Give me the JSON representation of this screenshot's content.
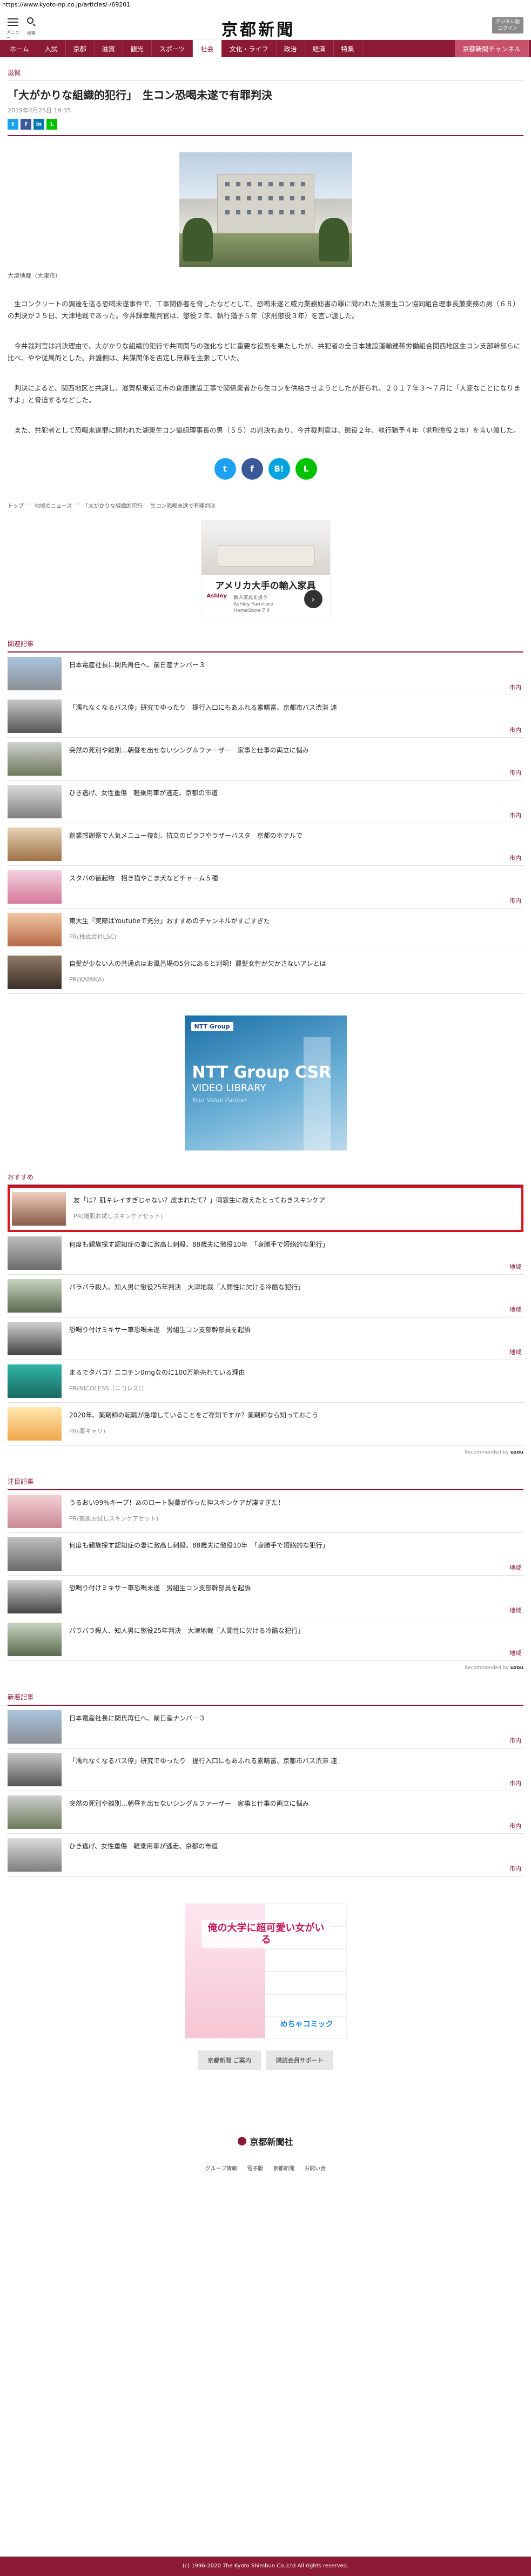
{
  "browser": {
    "url": "https://www.kyoto-np.co.jp/articles/-/69201"
  },
  "header": {
    "menu_label": "メニュー",
    "search_label": "検索",
    "logo": "京都新聞",
    "digital_line1": "デジタル版",
    "digital_line2": "ログイン"
  },
  "nav": {
    "items": [
      "ホーム",
      "入試",
      "京都",
      "滋賀",
      "観光",
      "スポーツ",
      "社会",
      "文化・ライフ",
      "政治",
      "経済",
      "特集"
    ],
    "special": "京都新聞チャンネル"
  },
  "article": {
    "section": "滋賀",
    "title": "「大がかりな組織的犯行」　生コン恐喝未遂で有罪判決",
    "date": "2019年4月25日 19:35",
    "caption": "大津地裁（大津市）",
    "paragraphs": [
      "生コンクリートの調達を巡る恐喝未遂事件で、工事関係者を脅したなどとして、恐喝未遂と威力業務妨害の罪に問われた湖東生コン協同組合理事長兼業務の男（６８）の判決が２５日、大津地裁であった。今井輝幸裁判官は、懲役２年、執行猶予５年（求刑懲役３年）を言い渡した。",
      "今井裁判官は判決理由で、大がかりな組織的犯行で共同関与の強化などに重要な役割を果たしたが、共犯者の全日本建設運輸連帯労働組合関西地区生コン支部幹部らに比べ、やや従属的とした。弁護側は、共謀関係を否定し無罪を主張していた。",
      "判決によると、関西地区と共謀し、滋賀県東近江市の倉庫建設工事で関係業者から生コンを供給させようとしたが断られ、２０１７年３〜７月に「大変なことになりますよ」と脅迫するなどした。",
      "また、共犯者として恐喝未遂罪に問われた湖東生コン協組理事長の男（５５）の判決もあり、今井裁判官は、懲役２年、執行猶予４年（求刑懲役２年）を言い渡した。"
    ]
  },
  "share": {
    "twitter": "t",
    "facebook": "f",
    "hatena": "B!",
    "line": "L",
    "linkedin": "in",
    "mini_line": "L"
  },
  "breadcrumb": [
    "トップ",
    "地域のニュース",
    "「大がかりな組織的犯行」　生コン恐喝未遂で有罪判決"
  ],
  "ad1": {
    "title": "アメリカ大手の輸入家具",
    "sub1": "輸入家具を扱う",
    "sub2": "Ashley Furniture",
    "sub3": "HomeStoreです",
    "brand": "Ashley",
    "arrow": "›"
  },
  "related": {
    "title": "関連記事",
    "items": [
      {
        "text": "日本電産社長に関氏再任へ、前日産ナンバー３",
        "tag": "市内",
        "pr": ""
      },
      {
        "text": "「濡れなくなるバス停」研究でゆったり　提行入口にもあふれる素晴富、京都市バス渋滞 連",
        "tag": "市内",
        "pr": ""
      },
      {
        "text": "突然の死別や離別…朝昼を出せないシングルファーザー　家事と仕事の両立に悩み",
        "tag": "市内",
        "pr": ""
      },
      {
        "text": "ひき逃げ、女性重傷　軽乗用車が逃走、京都の市道",
        "tag": "市内",
        "pr": ""
      },
      {
        "text": "創業感謝祭で人気メニュー復刻、抗立のピラフやラザーバスタ　京都のホテルで",
        "tag": "市内",
        "pr": ""
      },
      {
        "text": "スタバの徳起物　招き猫やこま犬などチャーム５種",
        "tag": "市内",
        "pr": ""
      },
      {
        "text": "東大生「実際はYoutubeで充分」おすすめのチャンネルがすごすぎた",
        "tag": "",
        "pr": "PR(株式会社LSC)"
      },
      {
        "text": "自髪が少ない人の共通点はお風呂場の5分にあると判明！農髪女性が欠かさないアレとは",
        "tag": "",
        "pr": "PR(KAMIKA)"
      }
    ]
  },
  "ad2": {
    "brand": "NTT Group",
    "line1": "NTT Group CSR",
    "line2": "VIDEO LIBRARY",
    "line3": "Your Value Partner"
  },
  "recommend": {
    "title": "おすすめ",
    "items": [
      {
        "text": "友「は？肌キレイすぎじゃない？皮まれたて？」同窓生に教えたとっておきスキンケア",
        "tag": "",
        "pr": "PR(雑肌お試しスキンケアセット)"
      },
      {
        "text": "何度も親族探す認知症の妻に激高し刺殺、88歳夫に懲役10年　「身勝手で短絡的な犯行」",
        "tag": "地域",
        "pr": ""
      },
      {
        "text": "パラパラ殺人、知人男に懲役25年判決　大津地裁「人間性に欠ける冷酷な犯行」",
        "tag": "地域",
        "pr": ""
      },
      {
        "text": "恐喝り付けミキサー車恐喝未遂　労組生コン支部幹部員を起訴",
        "tag": "地域",
        "pr": ""
      },
      {
        "text": "まるでタバコ？ニコチン0mgなのに100万箱売れている理由",
        "tag": "",
        "pr": "PR(NICOLESS（ニコレス）)"
      },
      {
        "text": "2020年、薬剤師の転職が急増していることをご存知ですか？薬剤師なら知っておこう",
        "tag": "",
        "pr": "PR(薬キャリ)"
      }
    ],
    "recommended_by": "Recommended by",
    "recommended_brand": "uzou"
  },
  "attention": {
    "title": "注目記事",
    "items": [
      {
        "text": "うるおい99％キープ！あのロート製薬が作った神スキンケアが凄すぎた！",
        "tag": "",
        "pr": "PR(雑肌お試しスキンケアセット)"
      },
      {
        "text": "何度も親族探す認知症の妻に激高し刺殺、88歳夫に懲役10年　「身勝手で短絡的な犯行」",
        "tag": "地域",
        "pr": ""
      },
      {
        "text": "恐喝り付けミキサー車恐喝未遂　労組生コン支部幹部員を起訴",
        "tag": "地域",
        "pr": ""
      },
      {
        "text": "パラパラ殺人、知人男に懲役25年判決　大津地裁「人間性に欠ける冷酷な犯行」",
        "tag": "地域",
        "pr": ""
      }
    ],
    "recommended_by": "Recommended by",
    "recommended_brand": "uzou"
  },
  "latest": {
    "title": "新着記事",
    "items": [
      {
        "text": "日本電産社長に関氏再任へ、前日産ナンバー３",
        "tag": "市内",
        "pr": ""
      },
      {
        "text": "「濡れなくなるバス停」研究でゆったり　提行入口にもあふれる素晴富、京都市バス渋滞 連",
        "tag": "市内",
        "pr": ""
      },
      {
        "text": "突然の死別や離別…朝昼を出せないシングルファーザー　家事と仕事の両立に悩み",
        "tag": "市内",
        "pr": ""
      },
      {
        "text": "ひき逃げ、女性重傷　軽乗用車が逃走、京都の市道",
        "tag": "市内",
        "pr": ""
      }
    ]
  },
  "ad3": {
    "headline": "俺の大学に超可愛い女がいる",
    "logo": "めちゃコミック"
  },
  "buttons": {
    "digital": "京都新聞 ご案内",
    "service": "購読会員サポート"
  },
  "footer": {
    "logo": "京都新聞社",
    "links": [
      "グループ情報",
      "電子版",
      "京都新聞",
      "お問い合"
    ],
    "copyright": "(c) 1996-2020 The Kyoto Shimbun Co.,Ltd All rights reserved."
  },
  "colors": {
    "brand": "#8c1a35",
    "highlight": "#d9141d",
    "twitter": "#1da1f2",
    "facebook": "#3b5998",
    "hatena": "#00a4de",
    "line": "#00c300"
  }
}
